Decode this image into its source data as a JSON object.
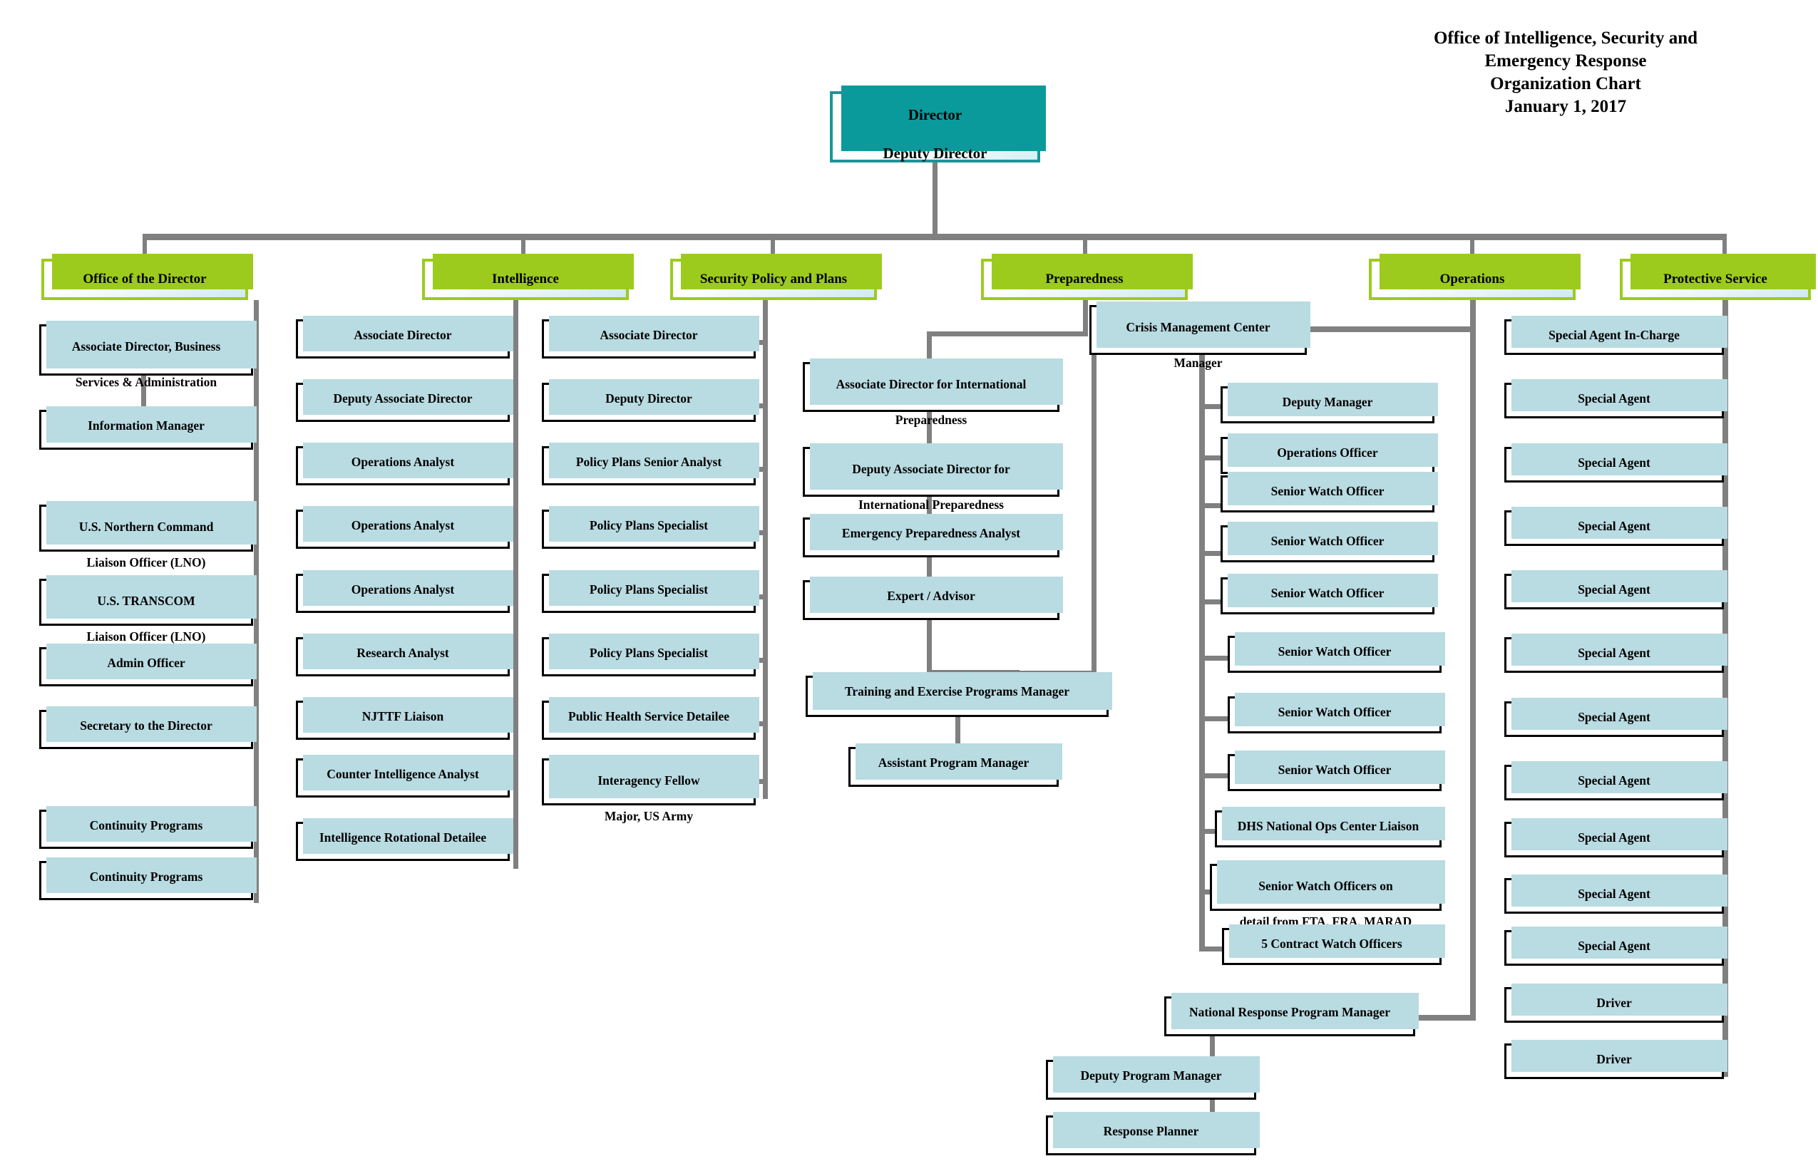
{
  "title": {
    "line1": "Office of Intelligence, Security and",
    "line2": "Emergency Response",
    "line3": "Organization Chart",
    "line4": "January 1, 2017"
  },
  "colors": {
    "root_border": "#1a9698",
    "root_shadow": "#0b9a9c",
    "division_border": "#9ccb1d",
    "node_border": "#000000",
    "node_shadow": "#b9dbe2",
    "connector": "#808080",
    "background": "#ffffff"
  },
  "root": {
    "line1": "Director",
    "line2": "Deputy Director"
  },
  "divisions": [
    {
      "label": "Office of the Director"
    },
    {
      "label": "Intelligence"
    },
    {
      "label": "Security Policy and Plans"
    },
    {
      "label": "Preparedness"
    },
    {
      "label": "Operations"
    },
    {
      "label": "Protective Service"
    }
  ],
  "office_of_director": [
    {
      "line1": "Associate Director, Business",
      "line2": "Services & Administration"
    },
    {
      "line1": "Information Manager",
      "line2": ""
    },
    {
      "line1": "U.S. Northern Command",
      "line2": "Liaison Officer (LNO)"
    },
    {
      "line1": "U.S. TRANSCOM",
      "line2": "Liaison Officer (LNO)"
    },
    {
      "line1": "Admin Officer",
      "line2": ""
    },
    {
      "line1": "Secretary to the Director",
      "line2": ""
    },
    {
      "line1": "Continuity Programs",
      "line2": ""
    },
    {
      "line1": "Continuity Programs",
      "line2": ""
    }
  ],
  "intelligence": [
    {
      "line1": "Associate Director",
      "line2": ""
    },
    {
      "line1": "Deputy Associate Director",
      "line2": ""
    },
    {
      "line1": "Operations Analyst",
      "line2": ""
    },
    {
      "line1": "Operations Analyst",
      "line2": ""
    },
    {
      "line1": "Operations Analyst",
      "line2": ""
    },
    {
      "line1": "Research Analyst",
      "line2": ""
    },
    {
      "line1": "NJTTF Liaison",
      "line2": ""
    },
    {
      "line1": "Counter Intelligence Analyst",
      "line2": ""
    },
    {
      "line1": "Intelligence Rotational Detailee",
      "line2": ""
    }
  ],
  "security_policy_and_plans": [
    {
      "line1": "Associate Director",
      "line2": ""
    },
    {
      "line1": "Deputy Director",
      "line2": ""
    },
    {
      "line1": "Policy Plans Senior Analyst",
      "line2": ""
    },
    {
      "line1": "Policy Plans Specialist",
      "line2": ""
    },
    {
      "line1": "Policy Plans Specialist",
      "line2": ""
    },
    {
      "line1": "Policy Plans Specialist",
      "line2": ""
    },
    {
      "line1": "Public Health Service Detailee",
      "line2": ""
    },
    {
      "line1": "Interagency Fellow",
      "line2": "Major, US Army"
    }
  ],
  "preparedness": [
    {
      "line1": "Associate Director for International",
      "line2": "Preparedness"
    },
    {
      "line1": "Deputy Associate Director for",
      "line2": "International Preparedness"
    },
    {
      "line1": "Emergency Preparedness Analyst",
      "line2": ""
    },
    {
      "line1": "Expert / Advisor",
      "line2": ""
    }
  ],
  "preparedness_training": [
    {
      "line1": "Training and Exercise Programs Manager",
      "line2": ""
    },
    {
      "line1": "Assistant Program Manager",
      "line2": ""
    }
  ],
  "operations": {
    "crisis_center": {
      "line1": "Crisis Management Center",
      "line2": "Manager"
    },
    "crisis_children": [
      {
        "line1": "Deputy Manager",
        "line2": ""
      },
      {
        "line1": "Operations Officer",
        "line2": ""
      },
      {
        "line1": "Senior Watch Officer",
        "line2": ""
      },
      {
        "line1": "Senior Watch Officer",
        "line2": ""
      },
      {
        "line1": "Senior Watch Officer",
        "line2": ""
      },
      {
        "line1": "Senior Watch Officer",
        "line2": ""
      },
      {
        "line1": "Senior Watch Officer",
        "line2": ""
      },
      {
        "line1": "Senior Watch Officer",
        "line2": ""
      },
      {
        "line1": "DHS National Ops Center Liaison",
        "line2": ""
      },
      {
        "line1": "Senior Watch Officers on",
        "line2": "detail from FTA, FRA, MARAD"
      },
      {
        "line1": "5 Contract Watch Officers",
        "line2": ""
      }
    ],
    "national_response": {
      "line1": "National Response Program Manager",
      "line2": ""
    },
    "national_response_children": [
      {
        "line1": "Deputy Program Manager",
        "line2": ""
      },
      {
        "line1": "Response Planner",
        "line2": ""
      }
    ]
  },
  "protective_service": [
    {
      "line1": "Special Agent In-Charge",
      "line2": ""
    },
    {
      "line1": "Special Agent",
      "line2": ""
    },
    {
      "line1": "Special Agent",
      "line2": ""
    },
    {
      "line1": "Special Agent",
      "line2": ""
    },
    {
      "line1": "Special Agent",
      "line2": ""
    },
    {
      "line1": "Special Agent",
      "line2": ""
    },
    {
      "line1": "Special Agent",
      "line2": ""
    },
    {
      "line1": "Special Agent",
      "line2": ""
    },
    {
      "line1": "Special Agent",
      "line2": ""
    },
    {
      "line1": "Special Agent",
      "line2": ""
    },
    {
      "line1": "Special Agent",
      "line2": ""
    },
    {
      "line1": "Driver",
      "line2": ""
    },
    {
      "line1": "Driver",
      "line2": ""
    }
  ]
}
